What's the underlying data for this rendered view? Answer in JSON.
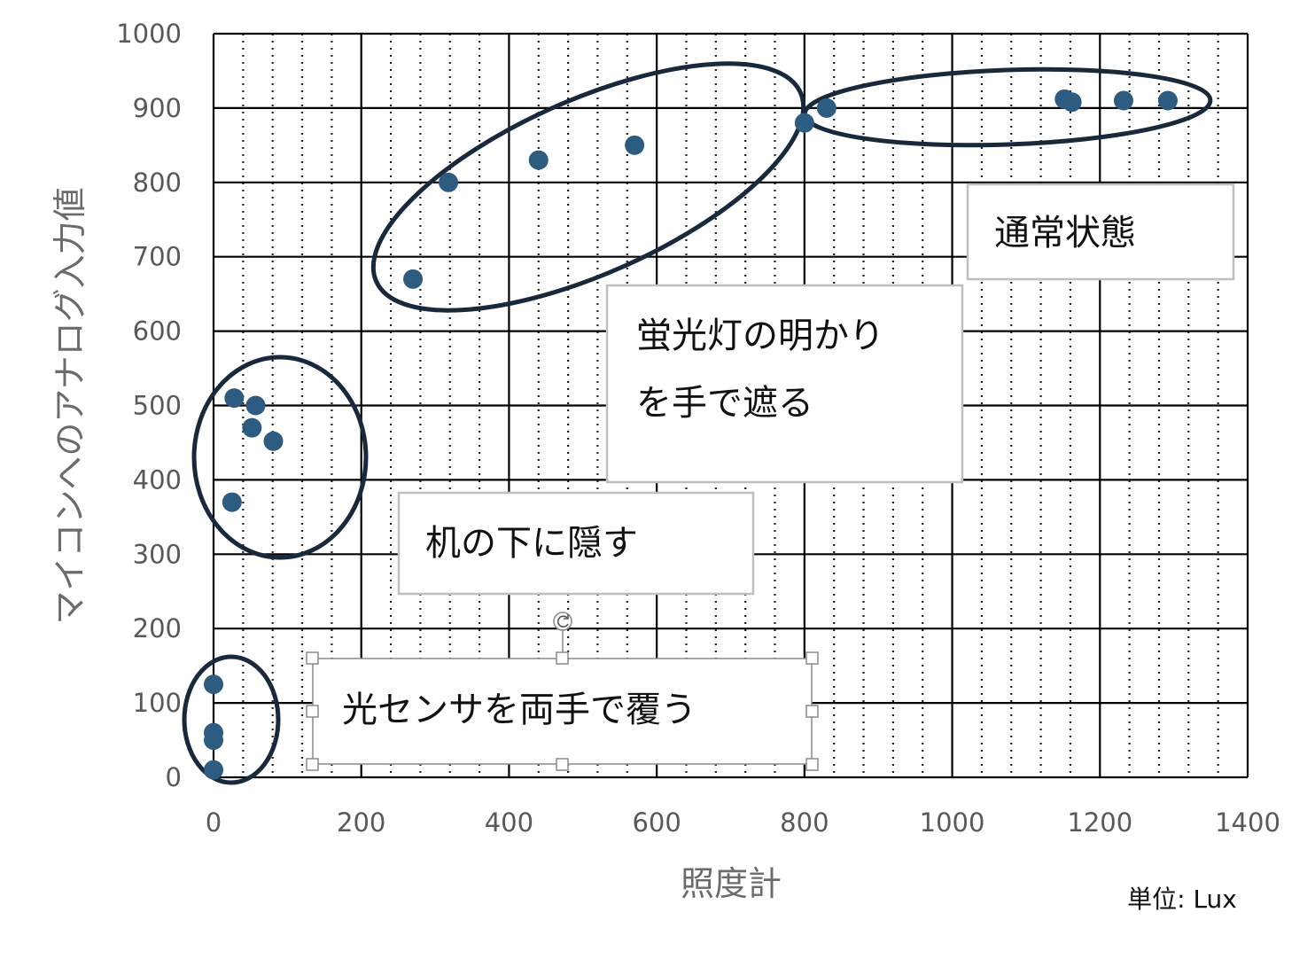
{
  "chart_data": {
    "type": "scatter",
    "xlabel": "照度計",
    "ylabel": "マイコンへのアナログ入力値",
    "unit_note": "単位: Lux",
    "xlim": [
      0,
      1400
    ],
    "ylim": [
      0,
      1000
    ],
    "x_ticks": [
      0,
      200,
      400,
      600,
      800,
      1000,
      1200,
      1400
    ],
    "y_ticks": [
      0,
      100,
      200,
      300,
      400,
      500,
      600,
      700,
      800,
      900,
      1000
    ],
    "x_ticks_text": [
      "0",
      "200",
      "400",
      "600",
      "800",
      "1000",
      "1200",
      "1400"
    ],
    "y_ticks_text": [
      "0",
      "100",
      "200",
      "300",
      "400",
      "500",
      "600",
      "700",
      "800",
      "900",
      "1000"
    ],
    "grid": {
      "major": true,
      "minor_dotted": true
    },
    "series": [
      {
        "color": "#2e5c80",
        "points": [
          {
            "x": 0,
            "y": 125
          },
          {
            "x": 0,
            "y": 60
          },
          {
            "x": 0,
            "y": 50
          },
          {
            "x": 0,
            "y": 10
          },
          {
            "x": 28,
            "y": 510
          },
          {
            "x": 57,
            "y": 500
          },
          {
            "x": 52,
            "y": 470
          },
          {
            "x": 81,
            "y": 452
          },
          {
            "x": 25,
            "y": 370
          },
          {
            "x": 270,
            "y": 670
          },
          {
            "x": 318,
            "y": 800
          },
          {
            "x": 440,
            "y": 830
          },
          {
            "x": 570,
            "y": 850
          },
          {
            "x": 800,
            "y": 880
          },
          {
            "x": 830,
            "y": 900
          },
          {
            "x": 1152,
            "y": 912
          },
          {
            "x": 1162,
            "y": 908
          },
          {
            "x": 1232,
            "y": 910
          },
          {
            "x": 1292,
            "y": 910
          }
        ]
      }
    ],
    "annotations": [
      {
        "text": [
          "通常状態"
        ]
      },
      {
        "text": [
          "蛍光灯の明かり",
          "を手で遮る"
        ]
      },
      {
        "text": [
          "机の下に隠す"
        ]
      },
      {
        "text": [
          "光センサを両手で覆う"
        ],
        "selected": true
      }
    ],
    "ellipse_color": "#17293a"
  }
}
